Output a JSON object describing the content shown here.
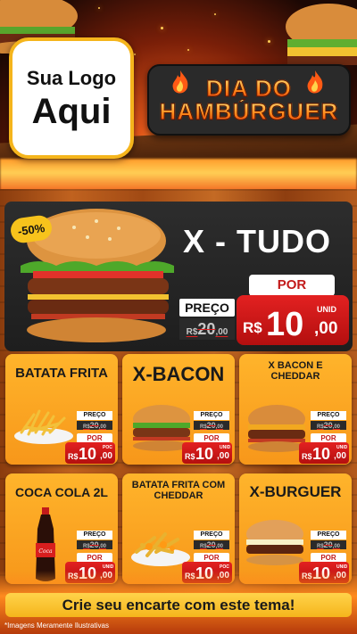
{
  "logo": {
    "line1": "Sua Logo",
    "line2": "Aqui"
  },
  "banner": {
    "line1": "DIA DO",
    "line2": "HAMBÚRGUER"
  },
  "featured": {
    "discount": "-50%",
    "name": "X - TUDO",
    "preco_label": "PREÇO",
    "old_int": "20",
    "old_dec": ",00",
    "old_cur": "R$",
    "por_label": "POR",
    "currency": "R$",
    "price_int": "10",
    "price_dec": ",00",
    "unit": "UNID"
  },
  "products": [
    {
      "name": "BATATA FRITA",
      "preco_label": "PREÇO",
      "old_cur": "R$",
      "old_int": "20",
      "old_dec": ",00",
      "por_label": "POR",
      "currency": "R$",
      "price_int": "10",
      "price_dec": ",00",
      "unit": "POC"
    },
    {
      "name": "X-BACON",
      "preco_label": "PREÇO",
      "old_cur": "R$",
      "old_int": "20",
      "old_dec": ",00",
      "por_label": "POR",
      "currency": "R$",
      "price_int": "10",
      "price_dec": ",00",
      "unit": "UNID"
    },
    {
      "name": "X BACON E CHEDDAR",
      "preco_label": "PREÇO",
      "old_cur": "R$",
      "old_int": "20",
      "old_dec": ",00",
      "por_label": "POR",
      "currency": "R$",
      "price_int": "10",
      "price_dec": ",00",
      "unit": "UNID"
    },
    {
      "name": "COCA COLA 2L",
      "preco_label": "PREÇO",
      "old_cur": "R$",
      "old_int": "20",
      "old_dec": ",00",
      "por_label": "POR",
      "currency": "R$",
      "price_int": "10",
      "price_dec": ",00",
      "unit": "UNID"
    },
    {
      "name": "BATATA FRITA COM CHEDDAR",
      "preco_label": "PREÇO",
      "old_cur": "R$",
      "old_int": "20",
      "old_dec": ",00",
      "por_label": "POR",
      "currency": "R$",
      "price_int": "10",
      "price_dec": ",00",
      "unit": "POC"
    },
    {
      "name": "X-BURGUER",
      "preco_label": "PREÇO",
      "old_cur": "R$",
      "old_int": "20",
      "old_dec": ",00",
      "por_label": "POR",
      "currency": "R$",
      "price_int": "10",
      "price_dec": ",00",
      "unit": "UNID"
    }
  ],
  "cta": "Crie seu encarte com este tema!",
  "disclaimer": "*Imagens Meramente Ilustrativas",
  "colors": {
    "orange": "#f7a01f",
    "red": "#d11a1a",
    "yellow": "#f5b51c",
    "dark": "#2a2a2a"
  },
  "icons": [
    "flame-icon",
    "burger-image",
    "fries-image",
    "soda-bottle-image"
  ]
}
